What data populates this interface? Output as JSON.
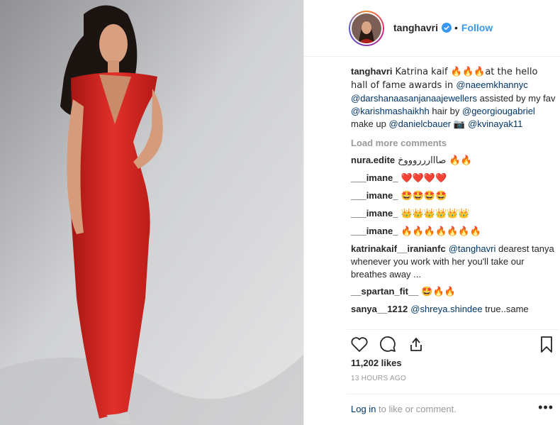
{
  "post": {
    "username": "tanghavri",
    "follow_label": "Follow",
    "separator": "•"
  },
  "caption": {
    "username": "tanghavri",
    "text_1": "Katrina kaif 🔥🔥🔥at the hello hall of fame awards in ",
    "mention_1": "@naeemkhannyc",
    "mention_2": "@darshanaasanjanaajewellers",
    "text_2": " assisted by my fav ",
    "mention_3": "@karishmashaikhh",
    "text_3": " hair by ",
    "mention_4": "@georgiougabriel",
    "text_4": " make up ",
    "mention_5": "@danielcbauer",
    "text_5": "📷 ",
    "mention_6": "@kvinayak11"
  },
  "load_more_label": "Load more comments",
  "comments": [
    {
      "user": "nura.edite",
      "text": "صاااررروووخ 🔥🔥"
    },
    {
      "user": "___imane_",
      "text": "❤️❤️❤️❤️"
    },
    {
      "user": "___imane_",
      "text": "🤩🤩🤩🤩"
    },
    {
      "user": "___imane_",
      "text": "👑👑👑👑👑👑"
    },
    {
      "user": "___imane_",
      "text": "🔥🔥🔥🔥🔥🔥🔥"
    },
    {
      "user": "katrinakaif__iranianfc",
      "mention": "@tanghavri",
      "text": " dearest tanya whenever you work with her you'll take our breathes away ..."
    },
    {
      "user": "__spartan_fit__",
      "text": "🤩🔥🔥"
    },
    {
      "user": "sanya__1212",
      "mention": "@shreya.shindee",
      "text": " true..same"
    }
  ],
  "likes": "11,202 likes",
  "timestamp": "13 HOURS AGO",
  "footer": {
    "login_label": "Log in",
    "login_suffix": " to like or comment.",
    "more_label": "•••"
  },
  "colors": {
    "accent": "#3897f0",
    "mention": "#003569",
    "muted": "#999999",
    "dress": "#d9221f"
  },
  "icons": [
    "verified-badge-icon",
    "heart-icon",
    "comment-icon",
    "share-icon",
    "bookmark-icon",
    "more-options-icon"
  ]
}
